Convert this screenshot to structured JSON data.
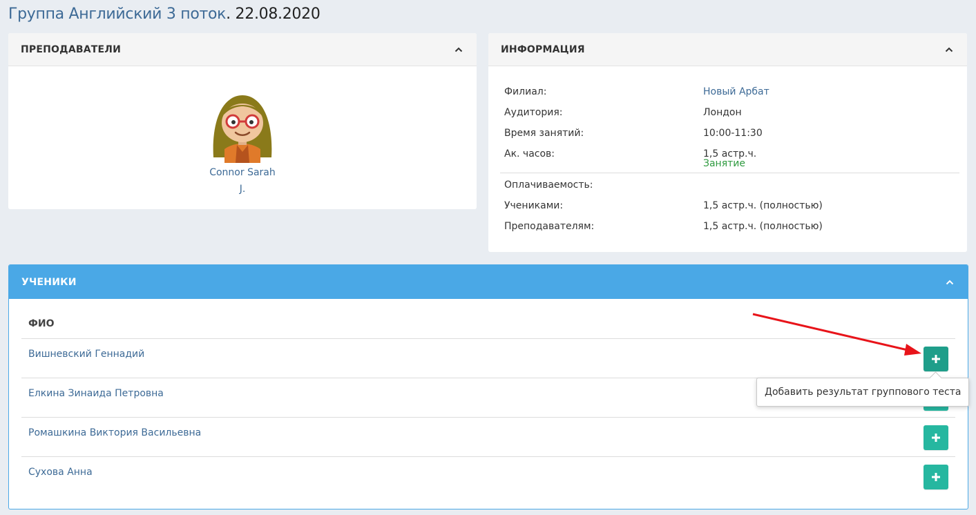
{
  "header": {
    "title_link": "Группа Английский 3 поток",
    "title_date": ". 22.08.2020"
  },
  "teachers_panel": {
    "title": "ПРЕПОДАВАТЕЛИ",
    "teacher": {
      "name_line1": "Connor Sarah",
      "name_line2": "J."
    }
  },
  "info_panel": {
    "title": "ИНФОРМАЦИЯ",
    "rows": [
      {
        "label": "Филиал:",
        "value": "Новый Арбат"
      },
      {
        "label": "Аудитория:",
        "value": "Лондон"
      },
      {
        "label": "Время занятий:",
        "value": "10:00-11:30"
      },
      {
        "label": "Ак. часов:",
        "value": "1,5 астр.ч.",
        "sub": "Занятие"
      }
    ],
    "payment": {
      "label": "Оплачиваемость:",
      "rows": [
        {
          "label": "Учениками:",
          "value": "1,5 астр.ч. (полностью)"
        },
        {
          "label": "Преподавателям:",
          "value": "1,5 астр.ч. (полностью)"
        }
      ]
    }
  },
  "students_panel": {
    "title": "УЧЕНИКИ",
    "column_header": "ФИО",
    "students": [
      {
        "name": "Вишневский Геннадий"
      },
      {
        "name": "Елкина Зинаида Петровна"
      },
      {
        "name": "Ромашкина Виктория Васильевна"
      },
      {
        "name": "Сухова Анна"
      }
    ],
    "add_button_icon": "plus-icon",
    "tooltip": "Добавить результат группового теста"
  },
  "colors": {
    "accent_blue": "#4aa8e6",
    "link": "#3d6a96",
    "add_button": "#26b7a0",
    "sub_green": "#2e9a3f",
    "annotation_arrow": "#e8141a"
  }
}
